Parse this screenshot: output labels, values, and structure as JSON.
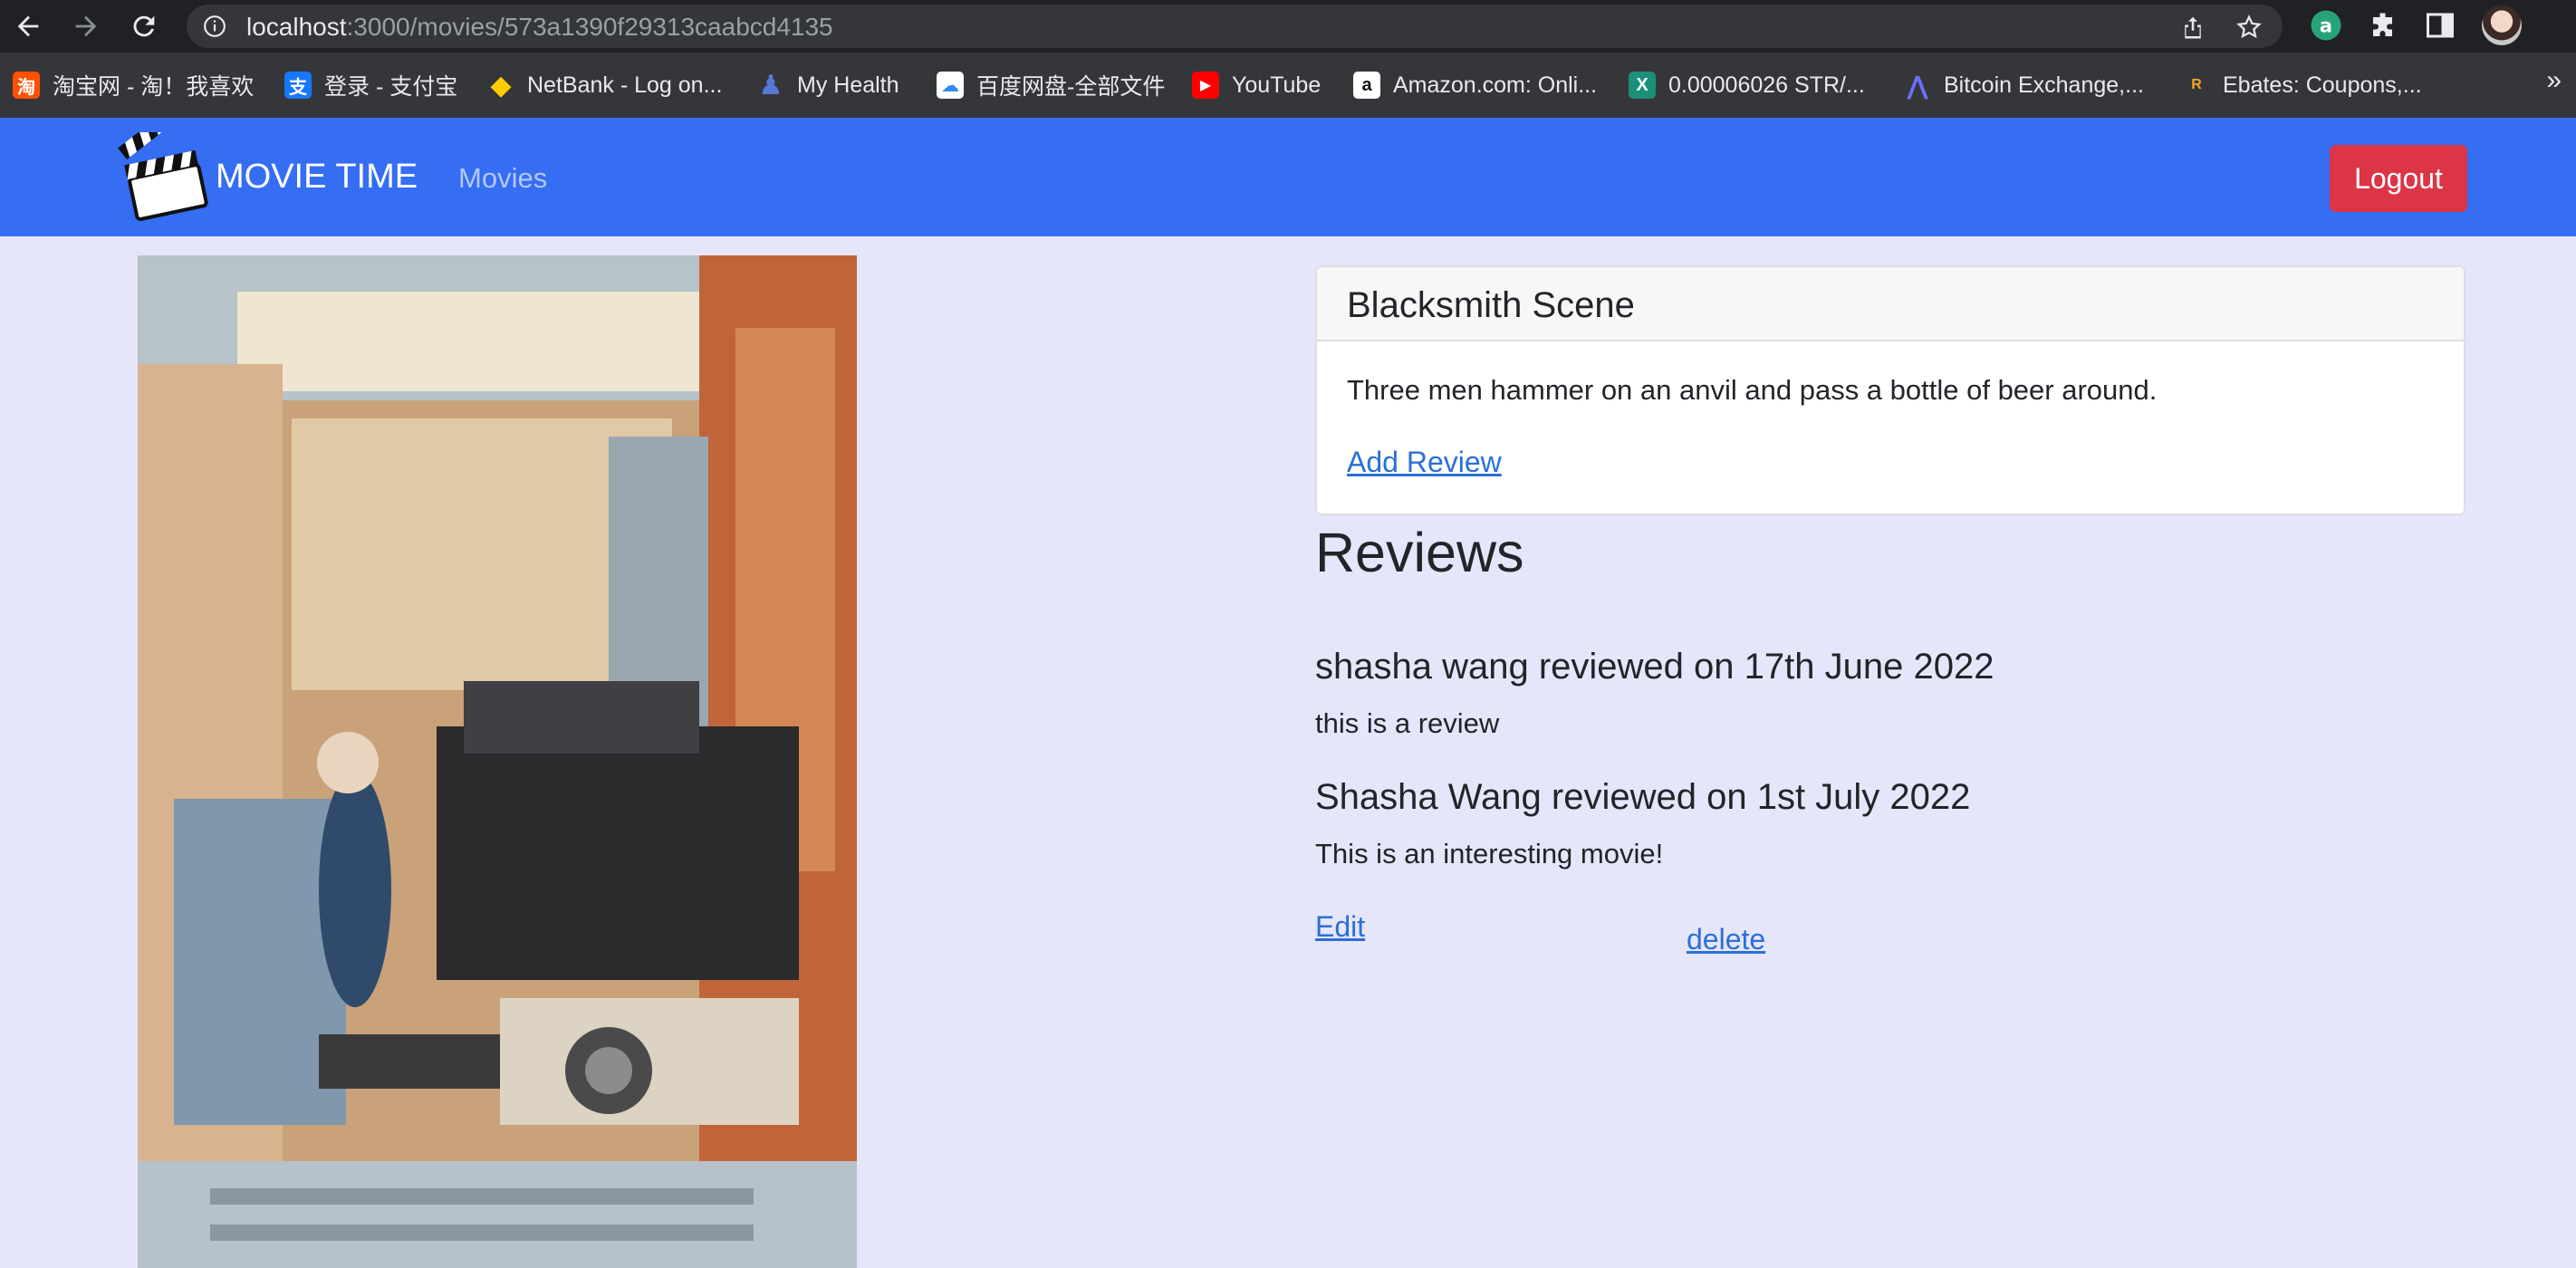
{
  "browser": {
    "url_host": "localhost",
    "url_path": ":3000/movies/573a1390f29313caabcd4135",
    "bookmarks": [
      {
        "label": "淘宝网 - 淘！我喜欢",
        "icon": "taobao-icon",
        "color": "#ff5000",
        "glyph": "淘"
      },
      {
        "label": "登录 - 支付宝",
        "icon": "alipay-icon",
        "color": "#1677ff",
        "glyph": "支"
      },
      {
        "label": "NetBank - Log on...",
        "icon": "netbank-icon",
        "color": "#ffcc00",
        "glyph": "◆"
      },
      {
        "label": "My Health",
        "icon": "myhealth-icon",
        "color": "#2f4fa8",
        "glyph": "♟"
      },
      {
        "label": "百度网盘-全部文件",
        "icon": "baidu-pan-icon",
        "color": "#ffffff",
        "glyph": "☁"
      },
      {
        "label": "YouTube",
        "icon": "youtube-icon",
        "color": "#ff0000",
        "glyph": "▶"
      },
      {
        "label": "Amazon.com: Onli...",
        "icon": "amazon-icon",
        "color": "#ffffff",
        "glyph": "a"
      },
      {
        "label": "0.00006026 STR/...",
        "icon": "exchange-icon",
        "color": "#1a8f7a",
        "glyph": "X"
      },
      {
        "label": "Bitcoin Exchange,...",
        "icon": "bitcoin-exchange-icon",
        "color": "#3b3fbf",
        "glyph": "⋀"
      },
      {
        "label": "Ebates: Coupons,...",
        "icon": "ebates-icon",
        "color": "#35363a",
        "glyph": "R"
      }
    ]
  },
  "navbar": {
    "brand": "MOVIE TIME",
    "link": "Movies",
    "logout": "Logout",
    "color": "#356df3"
  },
  "movie": {
    "title": "Blacksmith Scene",
    "plot": "Three men hammer on an anvil and pass a bottle of beer around.",
    "add_review": "Add Review"
  },
  "reviews": {
    "heading": "Reviews",
    "items": [
      {
        "header": "shasha wang reviewed on 17th June 2022",
        "text": "this is a review"
      },
      {
        "header": "Shasha Wang reviewed on 1st July 2022",
        "text": "This is an interesting movie!"
      }
    ],
    "edit": "Edit",
    "delete": "delete"
  }
}
